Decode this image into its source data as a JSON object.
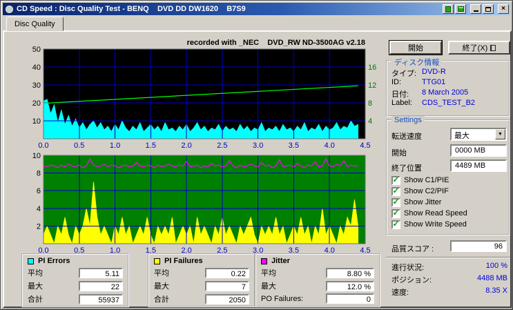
{
  "window": {
    "title": "CD Speed : Disc Quality Test - BENQ    DVD DD DW1620    B7S9"
  },
  "icons": {
    "app": "cd-disc",
    "copy": "green-copy",
    "save": "green-save",
    "minimize": "minimize",
    "maximize": "maximize",
    "close": "×",
    "dropdown": "▼",
    "check": "✓",
    "exit": "exit-door"
  },
  "tab": {
    "label": "Disc Quality"
  },
  "chart_header": "recorded with _NEC    DVD_RW ND-3500AG v2.18",
  "buttons": {
    "start": "開始",
    "exit": "終了(X)"
  },
  "disc_info": {
    "group_label": "ディスク情報",
    "rows": [
      {
        "label": "タイプ:",
        "value": "DVD-R"
      },
      {
        "label": "ID:",
        "value": "TTG01"
      },
      {
        "label": "日付:",
        "value": "8 March 2005"
      },
      {
        "label": "Label:",
        "value": "CDS_TEST_B2"
      }
    ]
  },
  "settings": {
    "group_label": "Settings",
    "speed_label": "転送速度",
    "speed_value": "最大",
    "start_label": "開始",
    "start_value": "0000 MB",
    "end_label": "終了位置",
    "end_value": "4489 MB",
    "checkboxes": [
      {
        "label": "Show C1/PIE",
        "checked": true
      },
      {
        "label": "Show C2/PIF",
        "checked": true
      },
      {
        "label": "Show Jitter",
        "checked": true
      },
      {
        "label": "Show Read Speed",
        "checked": true
      },
      {
        "label": "Show Write Speed",
        "checked": true
      }
    ]
  },
  "score": {
    "label": "品質スコア :",
    "value": "96"
  },
  "status": [
    {
      "label": "進行状況:",
      "value": "100 %"
    },
    {
      "label": "ポジション:",
      "value": "4488 MB"
    },
    {
      "label": "速度:",
      "value": "8.35 X"
    }
  ],
  "legends": [
    {
      "title": "PI Errors",
      "color": "#00ffff",
      "rows": [
        {
          "label": "平均",
          "value": "5.11"
        },
        {
          "label": "最大",
          "value": "22"
        },
        {
          "label": "合計",
          "value": "55937"
        }
      ]
    },
    {
      "title": "PI Failures",
      "color": "#ffff00",
      "rows": [
        {
          "label": "平均",
          "value": "0.22"
        },
        {
          "label": "最大",
          "value": "7"
        },
        {
          "label": "合計",
          "value": "2050"
        }
      ]
    },
    {
      "title": "Jitter",
      "color": "#ff00ff",
      "rows": [
        {
          "label": "平均",
          "value": "8.80 %"
        },
        {
          "label": "最大",
          "value": "12.0 %"
        },
        {
          "label": "PO Failures:",
          "value": "0"
        }
      ]
    }
  ],
  "chart_data": [
    {
      "type": "area",
      "name": "pi-errors-and-write-speed",
      "bg": "#000000",
      "grid_color": "#0000cc",
      "x_max": 4.5,
      "x_grid_step": 0.5,
      "x_ticks": [
        "0.0",
        "0.5",
        "1.0",
        "1.5",
        "2.0",
        "2.5",
        "3.0",
        "3.5",
        "4.0",
        "4.5"
      ],
      "x_tick_color": "#0000bb",
      "y_left": {
        "max": 50,
        "step": 10,
        "labels": [
          50,
          40,
          30,
          20,
          10
        ],
        "color": "#000000"
      },
      "y_right": {
        "max": 20,
        "labels": [
          16,
          12,
          8,
          4
        ],
        "color": "#007700"
      },
      "series": [
        {
          "name": "PI Errors",
          "type": "area",
          "color": "#00ffff",
          "x_step": 0.05,
          "values": [
            21,
            22,
            14,
            19,
            9,
            16,
            8,
            13,
            7,
            11,
            6,
            9,
            5,
            8,
            10,
            6,
            9,
            5,
            7,
            4,
            8,
            5,
            10,
            6,
            4,
            7,
            5,
            9,
            4,
            6,
            8,
            5,
            7,
            4,
            9,
            5,
            6,
            4,
            7,
            5,
            8,
            4,
            6,
            9,
            5,
            7,
            4,
            6,
            5,
            8,
            4,
            7,
            5,
            6,
            4,
            8,
            5,
            7,
            4,
            6,
            5,
            9,
            4,
            6,
            5,
            7,
            4,
            8,
            5,
            6,
            4,
            7,
            5,
            9,
            4,
            6,
            5,
            8,
            4,
            7,
            5,
            6,
            9,
            5,
            7,
            6,
            10,
            7,
            8
          ]
        },
        {
          "name": "Write Speed",
          "type": "line",
          "axis": "right",
          "color": "#00ff00",
          "points": [
            [
              0,
              7.9
            ],
            [
              4.4,
              11.8
            ]
          ]
        }
      ]
    },
    {
      "type": "area",
      "name": "pi-failures-and-jitter",
      "bg": "#008000",
      "grid_color": "#0000cc",
      "x_max": 4.5,
      "x_grid_step": 0.5,
      "x_ticks": [
        "0.0",
        "0.5",
        "1.0",
        "1.5",
        "2.0",
        "2.5",
        "3.0",
        "3.5",
        "4.0",
        "4.5"
      ],
      "x_tick_color": "#0000bb",
      "y_left": {
        "max": 10,
        "step": 2,
        "labels": [
          10,
          8,
          6,
          4,
          2
        ],
        "color": "#000000"
      },
      "series": [
        {
          "name": "PI Failures",
          "type": "area",
          "color": "#ffff00",
          "x_step": 0.05,
          "values": [
            1,
            2,
            1,
            0,
            2,
            1,
            3,
            1,
            0,
            2,
            1,
            2,
            4,
            2,
            7,
            3,
            1,
            2,
            1,
            0,
            2,
            1,
            3,
            1,
            2,
            0,
            1,
            2,
            1,
            3,
            1,
            0,
            2,
            1,
            2,
            1,
            3,
            0,
            1,
            2,
            1,
            2,
            0,
            3,
            1,
            2,
            1,
            0,
            2,
            1,
            3,
            1,
            2,
            1,
            0,
            2,
            1,
            2,
            3,
            1,
            0,
            2,
            1,
            2,
            1,
            3,
            1,
            2,
            0,
            1,
            2,
            1,
            3,
            1,
            2,
            0,
            2,
            1,
            4,
            1,
            2,
            1,
            0,
            2,
            1,
            3,
            2,
            5,
            2
          ]
        },
        {
          "name": "Jitter",
          "type": "line",
          "color": "#ff00ff",
          "x_step": 0.05,
          "values": [
            8.8,
            8.7,
            8.9,
            8.8,
            8.6,
            8.9,
            8.7,
            9.0,
            8.8,
            8.7,
            8.9,
            8.6,
            8.8,
            9.6,
            8.9,
            8.7,
            8.8,
            9.0,
            8.7,
            8.9,
            8.8,
            8.6,
            8.8,
            8.9,
            8.7,
            8.8,
            9.2,
            8.8,
            8.7,
            8.9,
            8.8,
            8.6,
            8.9,
            8.7,
            8.8,
            9.0,
            8.8,
            8.7,
            8.9,
            8.8,
            9.3,
            8.7,
            8.8,
            8.9,
            8.6,
            8.8,
            8.7,
            9.1,
            8.8,
            8.9,
            8.7,
            8.8,
            9.4,
            8.8,
            8.6,
            8.9,
            8.7,
            8.8,
            9.0,
            8.8,
            8.7,
            9.2,
            8.8,
            8.9,
            8.6,
            8.8,
            9.5,
            8.7,
            8.8,
            8.9,
            8.7,
            9.1,
            8.8,
            8.6,
            8.9,
            8.8,
            9.3,
            8.7,
            8.8,
            9.6,
            8.8,
            8.7,
            9.0,
            8.8,
            9.4,
            8.7,
            8.9,
            8.8,
            8.8
          ]
        }
      ]
    }
  ]
}
